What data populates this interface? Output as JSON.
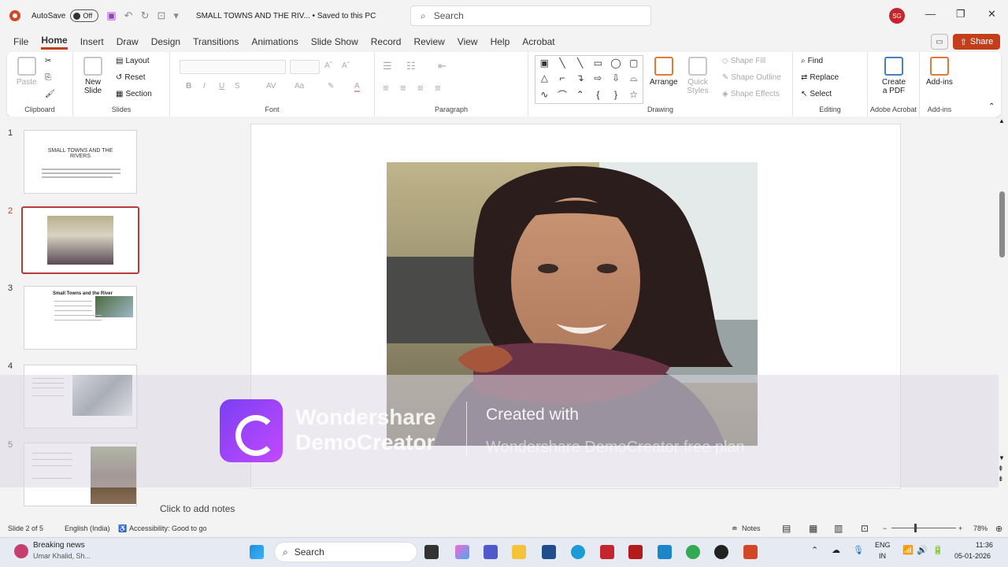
{
  "titlebar": {
    "autosave_label": "AutoSave",
    "autosave_state": "Off",
    "document_title": "SMALL TOWNS AND THE RIV... • Saved to this PC",
    "search_placeholder": "Search",
    "user_initials": "SG"
  },
  "menu": {
    "items": [
      "File",
      "Home",
      "Insert",
      "Draw",
      "Design",
      "Transitions",
      "Animations",
      "Slide Show",
      "Record",
      "Review",
      "View",
      "Help",
      "Acrobat"
    ],
    "active": "Home",
    "share_label": "Share"
  },
  "ribbon": {
    "clipboard": {
      "paste": "Paste",
      "label": "Clipboard"
    },
    "slides": {
      "new_slide": "New Slide",
      "layout": "Layout",
      "reset": "Reset",
      "section": "Section",
      "label": "Slides"
    },
    "font": {
      "label": "Font",
      "bold": "B",
      "italic": "I",
      "underline": "U",
      "strike": "S",
      "grow": "Aˆ",
      "shrink": "Aˇ",
      "spacing": "AV",
      "case": "Aa",
      "color": "A"
    },
    "paragraph": {
      "label": "Paragraph"
    },
    "drawing": {
      "arrange": "Arrange",
      "quick_styles": "Quick Styles",
      "shape_fill": "Shape Fill",
      "shape_outline": "Shape Outline",
      "shape_effects": "Shape Effects",
      "label": "Drawing"
    },
    "editing": {
      "find": "Find",
      "replace": "Replace",
      "select": "Select",
      "label": "Editing"
    },
    "acrobat": {
      "create_pdf": "Create a PDF",
      "label": "Adobe Acrobat"
    },
    "addins": {
      "addins": "Add-ins",
      "label": "Add-ins"
    }
  },
  "slides_panel": {
    "thumbnails": [
      {
        "number": "1",
        "title": "SMALL TOWNS AND THE RIVERS"
      },
      {
        "number": "2"
      },
      {
        "number": "3",
        "title": "Small Towns and the River"
      },
      {
        "number": "4"
      },
      {
        "number": "5"
      }
    ],
    "active_index": 2
  },
  "notes": {
    "placeholder": "Click to add notes"
  },
  "watermark": {
    "brand": "Wondershare DemoCreator",
    "created": "Created with",
    "plan": "Wondershare DemoCreator free plan"
  },
  "status": {
    "slide_info": "Slide 2 of 5",
    "language": "English (India)",
    "accessibility": "Accessibility: Good to go",
    "notes": "Notes",
    "zoom": "78%"
  },
  "taskbar": {
    "news_title": "Breaking news",
    "news_sub": "Umar Khalid, Sh...",
    "search": "Search",
    "lang": "ENG",
    "region": "IN",
    "time": "11:36",
    "date": "05-01-2026"
  },
  "colors": {
    "accent": "#c43e1c",
    "active_thumb_border": "#b73b3b"
  }
}
